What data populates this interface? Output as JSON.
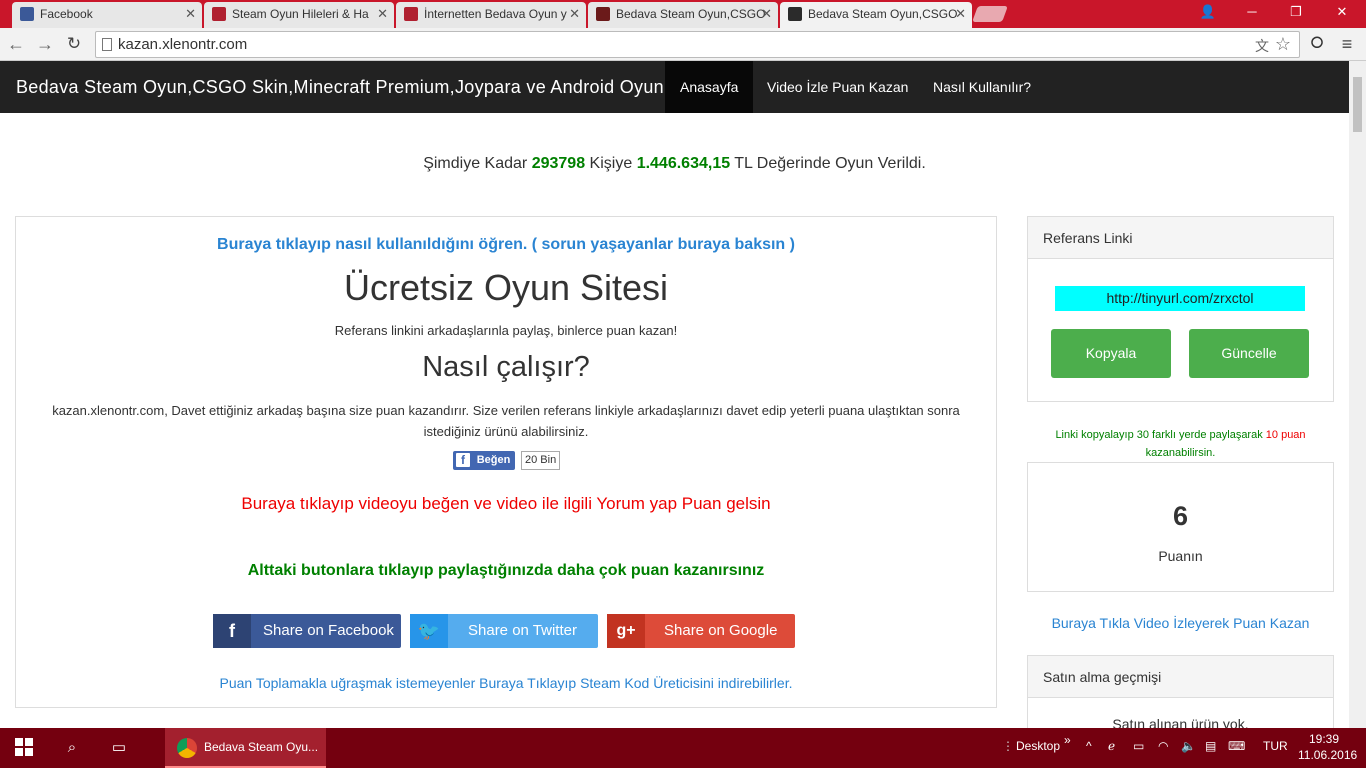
{
  "browser": {
    "tabs": [
      {
        "title": "Facebook",
        "color": "#3b5998"
      },
      {
        "title": "Steam Oyun Hileleri & Ha",
        "color": "#b02030"
      },
      {
        "title": "İnternetten Bedava Oyun y",
        "color": "#b02030"
      },
      {
        "title": "Bedava Steam Oyun,CSGO",
        "color": "#6b1a1a"
      },
      {
        "title": "Bedava Steam Oyun,CSGO",
        "color": "#2b2b2b"
      }
    ],
    "url": "kazan.xlenontr.com"
  },
  "site": {
    "brand": "Bedava Steam Oyun,CSGO Skin,Minecraft Premium,Joypara ve Android Oyunlar",
    "nav": [
      "Anasayfa",
      "Video İzle Puan Kazan",
      "Nasıl Kullanılır?"
    ],
    "stats": {
      "prefix": "Şimdiye Kadar",
      "count": "293798",
      "mid": "Kişiye",
      "amount": "1.446.634,15",
      "suffix": "TL Değerinde Oyun Verildi."
    }
  },
  "main": {
    "help_link": "Buraya tıklayıp nasıl kullanıldığını öğren. ( sorun yaşayanlar buraya baksın )",
    "title": "Ücretsiz Oyun Sitesi",
    "subtitle": "Referans linkini arkadaşlarınla paylaş, binlerce puan kazan!",
    "how_title": "Nasıl çalışır?",
    "how_text": "kazan.xlenontr.com, Davet ettiğiniz arkadaş başına size puan kazandırır. Size verilen referans linkiyle arkadaşlarınızı davet edip yeterli puana ulaştıktan sonra istediğiniz ürünü alabilirsiniz.",
    "like_label": "Beğen",
    "like_count": "20 Bin",
    "video_link": "Buraya tıklayıp videoyu beğen ve video ile ilgili Yorum yap Puan gelsin",
    "share_title": "Alttaki butonlara tıklayıp paylaştığınızda daha çok puan kazanırsınız",
    "share_buttons": [
      {
        "label": "Share on Facebook",
        "icon": "f",
        "color": "#3b5998"
      },
      {
        "label": "Share on Twitter",
        "icon": "t",
        "color": "#55acee"
      },
      {
        "label": "Share on Google",
        "icon": "g+",
        "color": "#dd4b39"
      }
    ],
    "footer_link": "Puan Toplamakla uğraşmak istemeyenler Buraya Tıklayıp Steam Kod Üreticisini indirebilirler."
  },
  "sidebar": {
    "ref_title": "Referans Linki",
    "ref_link": "http://tinyurl.com/zrxctol",
    "copy_button": "Kopyala",
    "update_button": "Güncelle",
    "hint_a": "Linki kopyalayıp 30 farklı yerde paylaşarak",
    "hint_points": "10 puan",
    "hint_b": "kazanabilirsin.",
    "points_value": "6",
    "points_label": "Puanın",
    "video_link": "Buraya Tıkla Video İzleyerek Puan Kazan",
    "history_title": "Satın alma geçmişi",
    "history_empty": "Satın alınan ürün yok."
  },
  "taskbar": {
    "app_label": "Bedava Steam Oyu...",
    "desktop": "Desktop",
    "lang": "TUR",
    "time": "19:39",
    "date": "11.06.2016"
  }
}
